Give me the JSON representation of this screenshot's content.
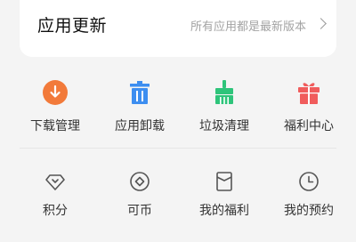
{
  "update": {
    "title": "应用更新",
    "status": "所有应用都是最新版本"
  },
  "tools": [
    {
      "label": "下载管理",
      "icon": "download-icon",
      "color": "#f27a3a"
    },
    {
      "label": "应用卸载",
      "icon": "trash-icon",
      "color": "#3d8ef0"
    },
    {
      "label": "垃圾清理",
      "icon": "broom-icon",
      "color": "#2ec47a"
    },
    {
      "label": "福利中心",
      "icon": "gift-icon",
      "color": "#f05c5c"
    }
  ],
  "benefits": [
    {
      "label": "积分",
      "icon": "diamond-icon"
    },
    {
      "label": "可币",
      "icon": "coin-icon"
    },
    {
      "label": "我的福利",
      "icon": "envelope-icon"
    },
    {
      "label": "我的预约",
      "icon": "clock-icon"
    }
  ]
}
